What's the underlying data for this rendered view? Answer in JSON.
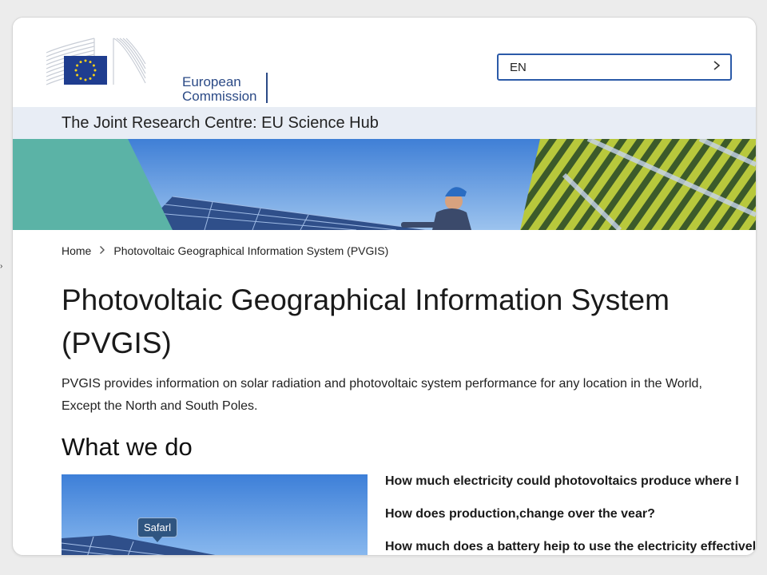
{
  "header": {
    "org_name_line1": "European",
    "org_name_line2": "Commission",
    "language_value": "EN"
  },
  "site": {
    "name": "The Joint Research Centre: EU Science Hub"
  },
  "breadcrumb": {
    "home": "Home",
    "current": "Photovoltaic Geographical Information System (PVGIS)"
  },
  "page": {
    "title": "Photovoltaic Geographical Information System (PVGIS)",
    "intro": "PVGIS provides information on solar radiation and photovoltaic system performance for any location in the World, Except the North and South Poles."
  },
  "section": {
    "title": "What we do",
    "image_tooltip": "Safarl",
    "questions": [
      "How much electricity could photovoltaics produce where I",
      "How does production,change over the vear?",
      "How much does a battery heip to use the electricity effectivel\""
    ]
  },
  "colors": {
    "brand_blue": "#2b4a86",
    "accent_blue": "#2b5aa8",
    "band_bg": "#e8edf5",
    "teal": "#5bb3a6"
  },
  "icons": {
    "lang_chevron": "chevron-right-icon",
    "breadcrumb_sep": "chevron-right-icon"
  }
}
